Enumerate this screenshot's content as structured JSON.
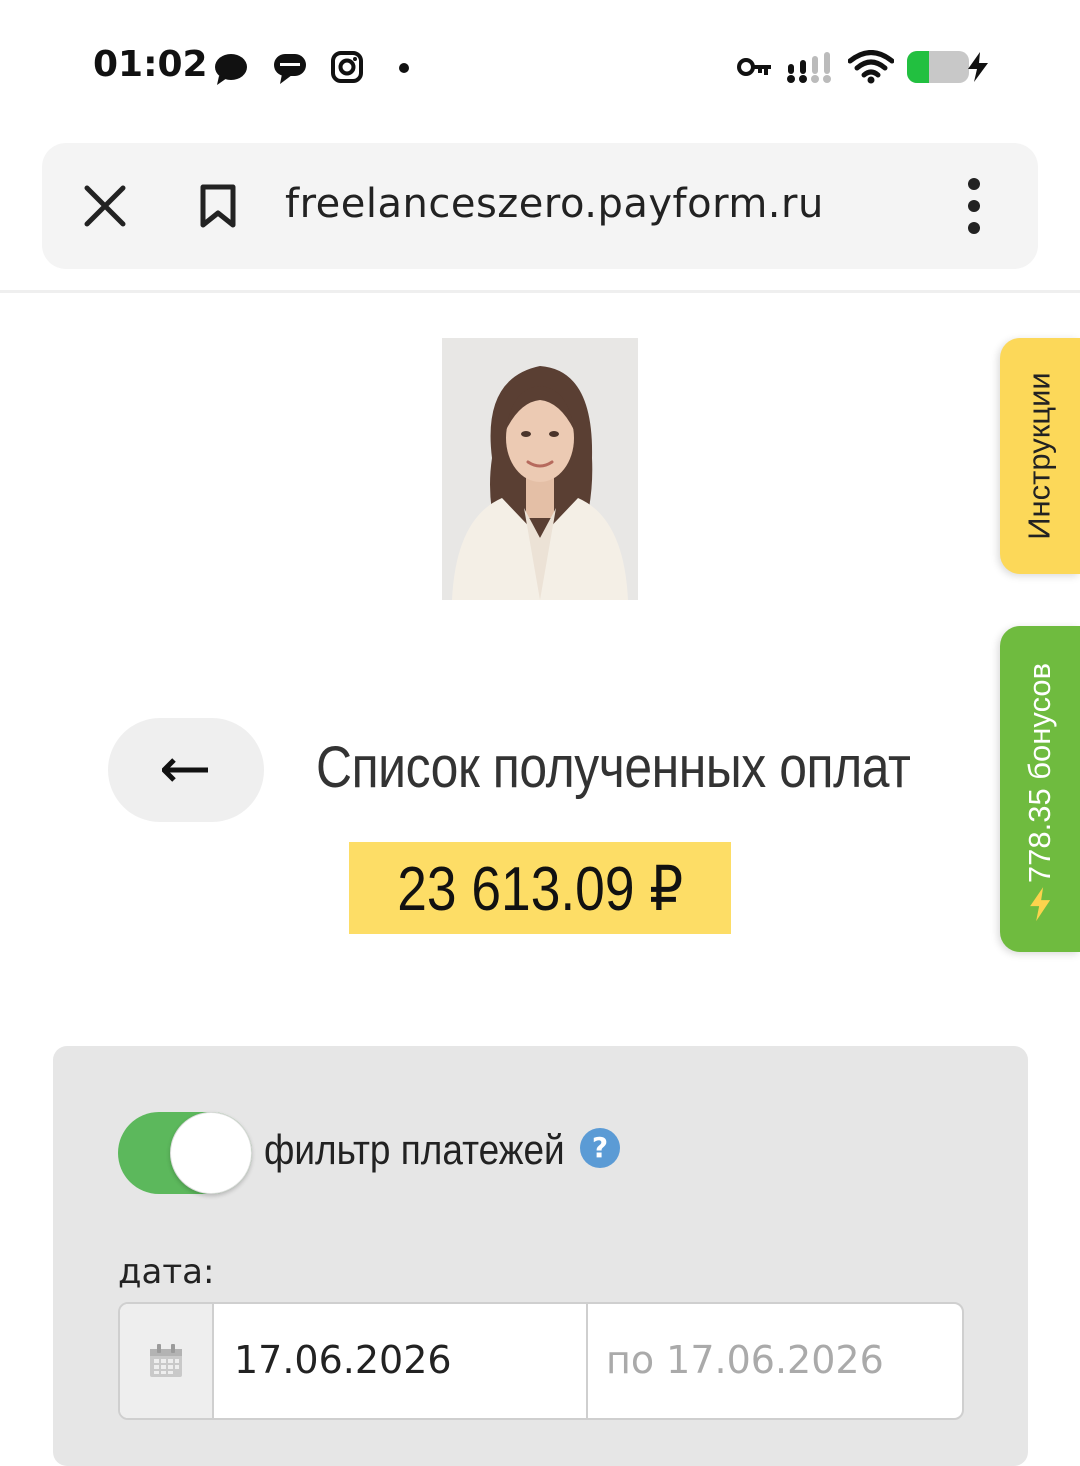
{
  "status_bar": {
    "time": "01:02",
    "notification_icons": [
      "chat-bubble-icon",
      "messages-icon",
      "instagram-icon",
      "dot-icon"
    ],
    "system_icons": [
      "vpn-key-icon",
      "signal-icon",
      "wifi-icon",
      "battery-icon",
      "charging-icon"
    ],
    "battery_level": 0.3
  },
  "browser": {
    "url": "freelanceszero.payform.ru"
  },
  "side_tabs": {
    "instructions_label": "Инструкции",
    "bonus_label": "778.35 бонусов",
    "instructions_color": "#fcd859",
    "bonus_color": "#6fbb3f"
  },
  "header": {
    "back_label": "←",
    "title": "Список полученных оплат",
    "amount": "23 613.09 ₽",
    "amount_bg": "#fddd66"
  },
  "filter": {
    "toggle_label": "фильтр платежей",
    "toggle_on": true,
    "help_symbol": "?",
    "date_label": "дата:",
    "date_from_value": "17.06.2026",
    "date_to_placeholder": "по 17.06.2026"
  }
}
